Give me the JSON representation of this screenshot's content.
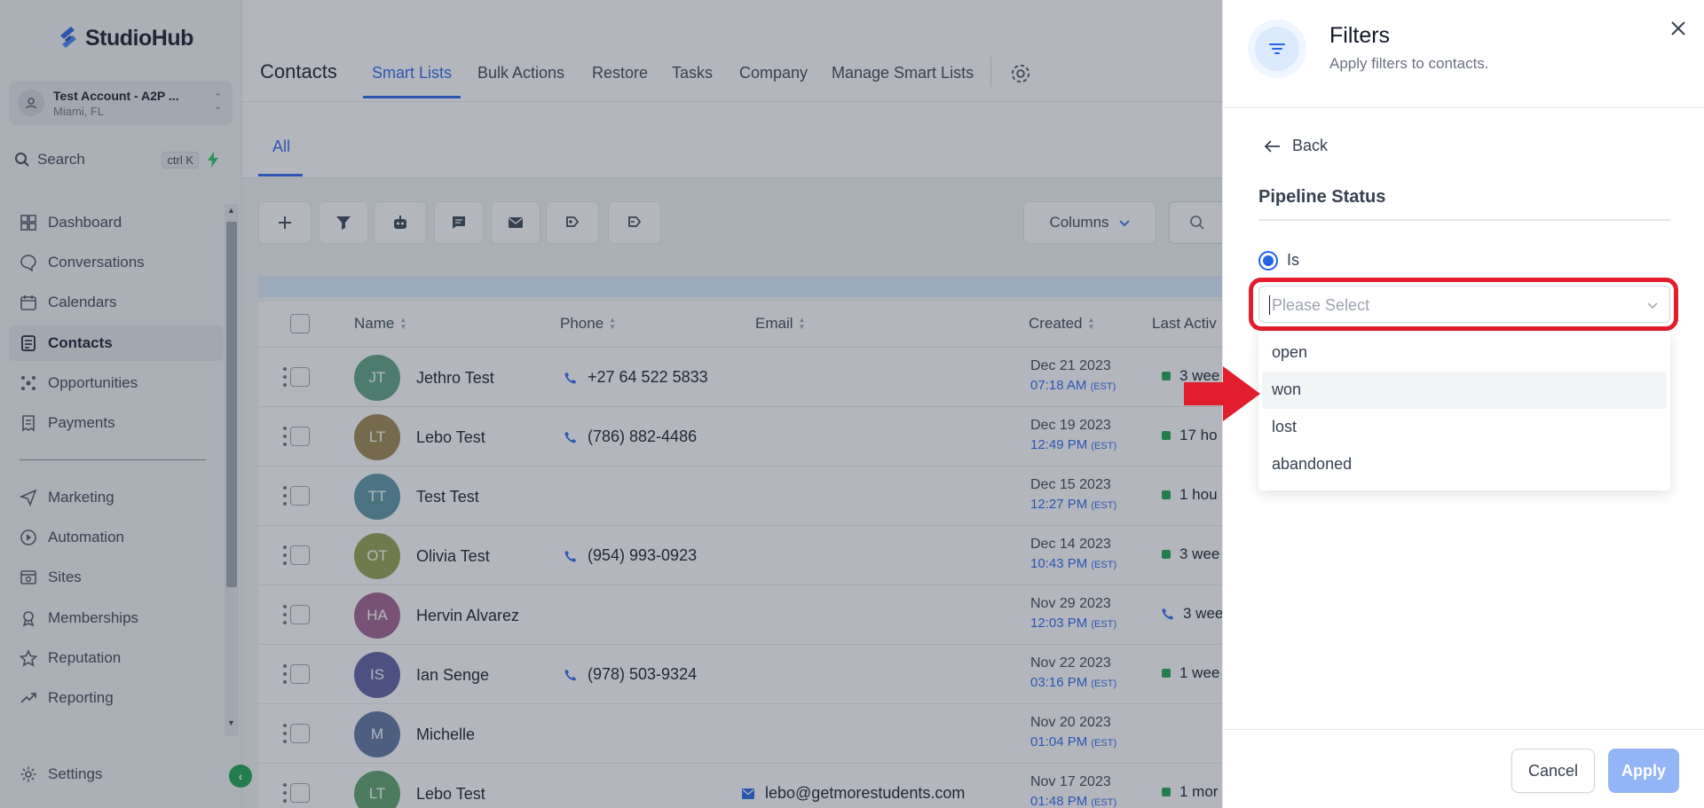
{
  "brand": {
    "name": "StudioHub"
  },
  "account": {
    "name": "Test Account - A2P ...",
    "location": "Miami, FL"
  },
  "search": {
    "label": "Search",
    "shortcut": "ctrl K"
  },
  "sidebar": {
    "items": [
      {
        "label": "Dashboard",
        "icon": "dashboard-icon"
      },
      {
        "label": "Conversations",
        "icon": "chat-bubble-icon"
      },
      {
        "label": "Calendars",
        "icon": "calendar-icon"
      },
      {
        "label": "Contacts",
        "icon": "contacts-icon",
        "active": true
      },
      {
        "label": "Opportunities",
        "icon": "opportunities-icon"
      },
      {
        "label": "Payments",
        "icon": "receipt-icon"
      }
    ],
    "items2": [
      {
        "label": "Marketing",
        "icon": "send-icon"
      },
      {
        "label": "Automation",
        "icon": "automation-icon"
      },
      {
        "label": "Sites",
        "icon": "sites-icon"
      },
      {
        "label": "Memberships",
        "icon": "memberships-icon"
      },
      {
        "label": "Reputation",
        "icon": "star-icon"
      },
      {
        "label": "Reporting",
        "icon": "trend-icon"
      }
    ],
    "settings": "Settings"
  },
  "topnav": {
    "title": "Contacts",
    "tabs": [
      "Smart Lists",
      "Bulk Actions",
      "Restore",
      "Tasks",
      "Company",
      "Manage Smart Lists"
    ]
  },
  "subtabs": {
    "all": "All"
  },
  "toolbar": {
    "columns": "Columns"
  },
  "table": {
    "headers": {
      "name": "Name",
      "phone": "Phone",
      "email": "Email",
      "created": "Created",
      "last_activity": "Last Activ"
    },
    "rows": [
      {
        "initials": "JT",
        "name": "Jethro Test",
        "phone": "+27 64 522 5833",
        "email": "",
        "date": "Dec 21 2023",
        "time": "07:18 AM",
        "tz": "(EST)",
        "activity": "3 wee",
        "color": "#3f8f6a"
      },
      {
        "initials": "LT",
        "name": "Lebo Test",
        "phone": "(786) 882-4486",
        "email": "",
        "date": "Dec 19 2023",
        "time": "12:49 PM",
        "tz": "(EST)",
        "activity": "17 ho",
        "color": "#8a6f2a"
      },
      {
        "initials": "TT",
        "name": "Test Test",
        "phone": "",
        "email": "",
        "date": "Dec 15 2023",
        "time": "12:27 PM",
        "tz": "(EST)",
        "activity": "1 hou",
        "color": "#3d7f8f"
      },
      {
        "initials": "OT",
        "name": "Olivia Test",
        "phone": "(954) 993-0923",
        "email": "",
        "date": "Dec 14 2023",
        "time": "10:43 PM",
        "tz": "(EST)",
        "activity": "3 wee",
        "color": "#7f8f2a"
      },
      {
        "initials": "HA",
        "name": "Hervin Alvarez",
        "phone": "",
        "email": "",
        "date": "Nov 29 2023",
        "time": "12:03 PM",
        "tz": "(EST)",
        "activity": "3 wee",
        "color": "#8f3f7a"
      },
      {
        "initials": "IS",
        "name": "Ian Senge",
        "phone": "(978) 503-9324",
        "email": "",
        "date": "Nov 22 2023",
        "time": "03:16 PM",
        "tz": "(EST)",
        "activity": "1 wee",
        "color": "#3f3f8f"
      },
      {
        "initials": "M",
        "name": "Michelle",
        "phone": "",
        "email": "",
        "date": "Nov 20 2023",
        "time": "01:04 PM",
        "tz": "(EST)",
        "activity": "",
        "color": "#3f5a8f"
      },
      {
        "initials": "LT",
        "name": "Lebo Test",
        "phone": "",
        "email": "lebo@getmorestudents.com",
        "date": "Nov 17 2023",
        "time": "01:48 PM",
        "tz": "(EST)",
        "activity": "1 mor",
        "color": "#3f8f4a"
      }
    ]
  },
  "filters": {
    "title": "Filters",
    "subtitle": "Apply filters to contacts.",
    "back": "Back",
    "field": "Pipeline Status",
    "operator": "Is",
    "placeholder": "Please Select",
    "options": [
      "open",
      "won",
      "lost",
      "abandoned"
    ],
    "hovered_option": "won",
    "cancel": "Cancel",
    "apply": "Apply"
  },
  "colors": {
    "accent": "#2563eb",
    "highlight": "#e11d2e",
    "success": "#16a34a"
  }
}
